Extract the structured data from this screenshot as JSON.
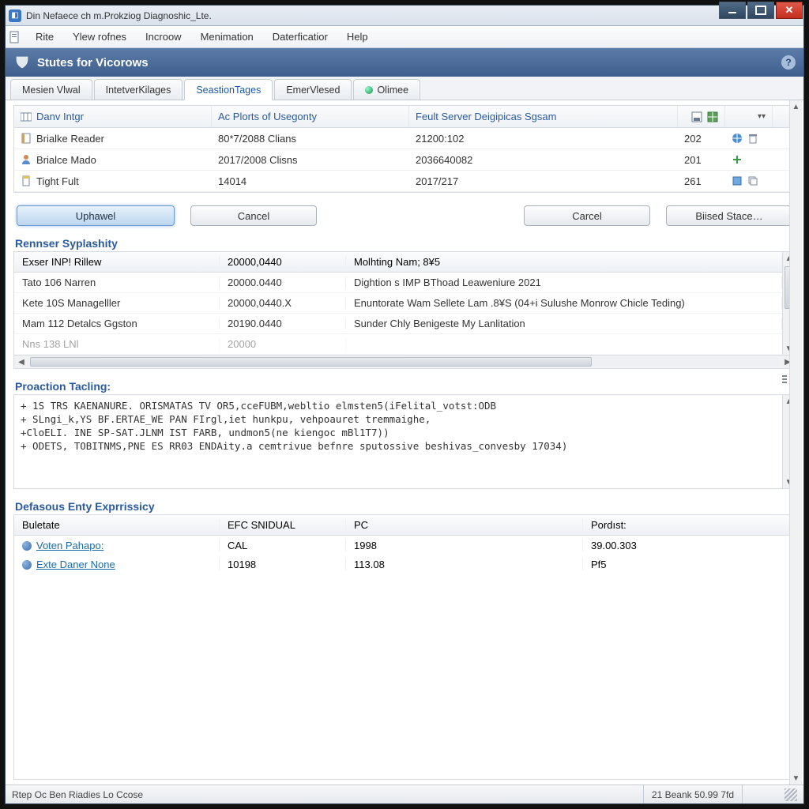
{
  "window": {
    "title": "Din Nefaece ch m.Prokziog Diagnoshic_Lte."
  },
  "menu": {
    "items": [
      "Rite",
      "Ylew rofnes",
      "Incroow",
      "Menimation",
      "Daterficatior",
      "Help"
    ]
  },
  "band": {
    "title": "Stutes for Vicorows"
  },
  "tabs": [
    {
      "label": "Mesien Vlwal",
      "active": false,
      "icon": ""
    },
    {
      "label": "IntetverKilages",
      "active": false,
      "icon": ""
    },
    {
      "label": "SeastionTages",
      "active": true,
      "icon": ""
    },
    {
      "label": "EmerVlesed",
      "active": false,
      "icon": ""
    },
    {
      "label": "Olimee",
      "active": false,
      "icon": "globe"
    }
  ],
  "grid1": {
    "headers": {
      "c0": "Danv Intgr",
      "c1": "Ac Plorts of Usegonty",
      "c2": "Feult Server Deigipicas Sgsam"
    },
    "rows": [
      {
        "icon": "book",
        "c0": "Brialke Reader",
        "c1": "80*7/2088 Clians",
        "c2": "21200:102",
        "c3": "202",
        "act": "globe"
      },
      {
        "icon": "person",
        "c0": "Brialce Mado",
        "c1": "2017/2008 Clisns",
        "c2": "2036640082",
        "c3": "201",
        "act": "plus"
      },
      {
        "icon": "doc",
        "c0": "Tight Fult",
        "c1": "14014",
        "c2": "2017/217",
        "c3": "261",
        "act": "disk"
      }
    ]
  },
  "buttons": {
    "primary": "Uphawel",
    "cancel1": "Cancel",
    "cancel2": "Carcel",
    "more": "Biised Stace…"
  },
  "section2": {
    "title": "Rennser Syplashity",
    "headers": {
      "c0": "Exser INP! Rillew",
      "c1": "20000,0440",
      "c2": "Molhting Nam; 8¥5"
    },
    "rows": [
      {
        "c0": "Tato 106 Narren",
        "c1": "20000.0440",
        "c2": "Dightion s IMP BThoad Leaweniure 2021"
      },
      {
        "c0": "Kete 10S Managelller",
        "c1": "20000,0440.X",
        "c2": "Enuntorate Wam Sellete Lam .8¥S (04+i Sulushe Monrow Chicle Teding)"
      },
      {
        "c0": "Mam 112 Detalcs Ggston",
        "c1": "20190.0440",
        "c2": "Sunder Chly Benigeste My Lanlitation"
      },
      {
        "c0": "Nns 138  LNl",
        "c1": "20000",
        "c2": ""
      }
    ]
  },
  "log": {
    "title": "Proaction Tacling:",
    "lines": [
      "+ 1S TRS KAENANURE. ORISMATAS TV OR5,cceFUBM,webltio elmsten5(iFelital_votst:ODB",
      "+ SLngi_k,YS BF.ERTAE_WE PAN FIrgl,iet hunkpu, vehpoauret tremmaighe,",
      "+CloELI. INE SP-SAT.JLNM IST FARB, undmon5(ne kiengoc mBl1T7))",
      "+ ODETS, TOBITNMS,PNE ES RR03 ENDAity.a cemtrivue befnre sputossive beshivas_convesby 17034)"
    ]
  },
  "section3": {
    "title": "Defasous Enty Exprrissicy",
    "headers": {
      "c0": "Buletate",
      "c1": "EFC SNIDUAL",
      "c2": "PC",
      "c3": "Pordıst:"
    },
    "rows": [
      {
        "c0": "Voten Pahapo:",
        "c1": "CAL",
        "c2": "1998",
        "c3": "39.00.303"
      },
      {
        "c0": "Exte Daner None",
        "c1": "10198",
        "c2": "113.08",
        "c3": "Pf5"
      }
    ]
  },
  "status": {
    "left": "Rtep Oc Ben Riadies Lo Ccose",
    "right": "21 Beank 50.99 7fd"
  }
}
